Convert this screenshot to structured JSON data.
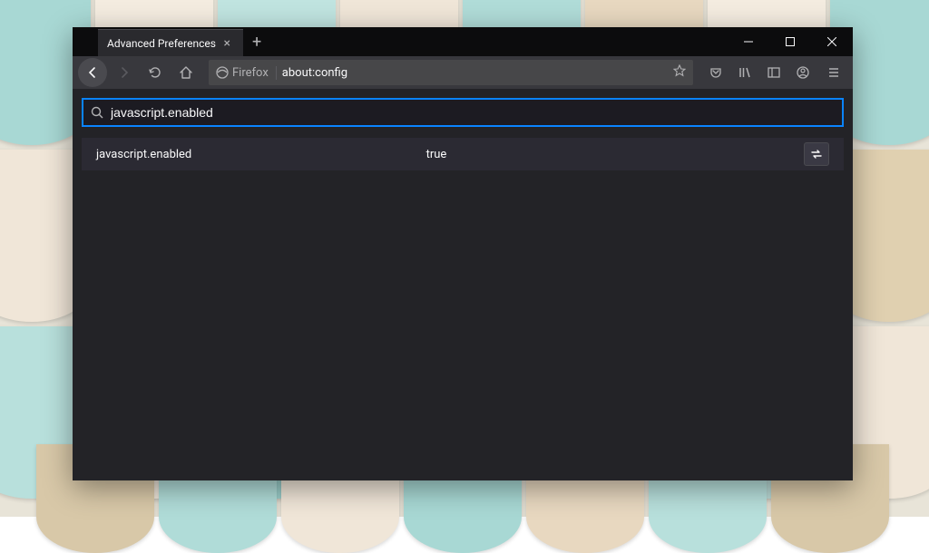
{
  "tab": {
    "title": "Advanced Preferences"
  },
  "urlbar": {
    "identity": "Firefox",
    "url": "about:config"
  },
  "search": {
    "value": "javascript.enabled"
  },
  "result": {
    "name": "javascript.enabled",
    "value": "true"
  },
  "wallpaper_colors": [
    "#a8d8d4",
    "#f0e6d8",
    "#d8c4a0",
    "#b8e0dc",
    "#e8d4b8",
    "#f4ece0"
  ]
}
